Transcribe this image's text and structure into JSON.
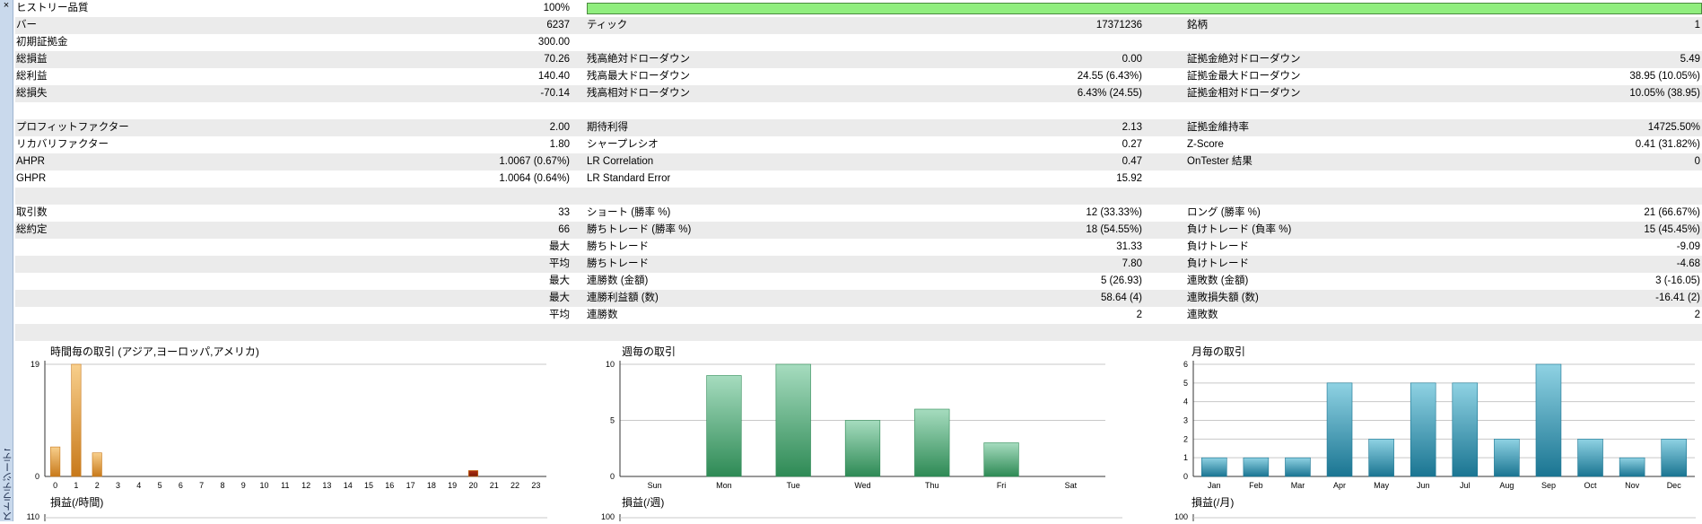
{
  "window": {
    "close_glyph": "×",
    "side_label": "ストラテジーテスター"
  },
  "report": {
    "rows": [
      {
        "l1": "ヒストリー品質",
        "v1": "100%",
        "bar": true,
        "alt": false,
        "history_quality_fraction": 1.0
      },
      {
        "l1": "バー",
        "v1": "6237",
        "l2": "ティック",
        "v2": "17371236",
        "l3": "銘柄",
        "v3": "1",
        "alt": true
      },
      {
        "l1": "初期証拠金",
        "v1": "300.00",
        "alt": false
      },
      {
        "l1": "総損益",
        "v1": "70.26",
        "l2": "残高絶対ドローダウン",
        "v2": "0.00",
        "l3": "証拠金絶対ドローダウン",
        "v3": "5.49",
        "alt": true
      },
      {
        "l1": "総利益",
        "v1": "140.40",
        "l2": "残高最大ドローダウン",
        "v2": "24.55 (6.43%)",
        "l3": "証拠金最大ドローダウン",
        "v3": "38.95 (10.05%)",
        "alt": false
      },
      {
        "l1": "総損失",
        "v1": "-70.14",
        "l2": "残高相対ドローダウン",
        "v2": "6.43% (24.55)",
        "l3": "証拠金相対ドローダウン",
        "v3": "10.05% (38.95)",
        "alt": true
      },
      {
        "alt": false
      },
      {
        "l1": "プロフィットファクター",
        "v1": "2.00",
        "l2": "期待利得",
        "v2": "2.13",
        "l3": "証拠金維持率",
        "v3": "14725.50%",
        "alt": true
      },
      {
        "l1": "リカバリファクター",
        "v1": "1.80",
        "l2": "シャープレシオ",
        "v2": "0.27",
        "l3": "Z-Score",
        "v3": "0.41 (31.82%)",
        "alt": false
      },
      {
        "l1": "AHPR",
        "v1": "1.0067 (0.67%)",
        "l2": "LR Correlation",
        "v2": "0.47",
        "l3": "OnTester 結果",
        "v3": "0",
        "alt": true
      },
      {
        "l1": "GHPR",
        "v1": "1.0064 (0.64%)",
        "l2": "LR Standard Error",
        "v2": "15.92",
        "alt": false
      },
      {
        "alt": true
      },
      {
        "l1": "取引数",
        "v1": "33",
        "l2": "ショート (勝率 %)",
        "v2": "12 (33.33%)",
        "l3": "ロング (勝率 %)",
        "v3": "21 (66.67%)",
        "alt": false
      },
      {
        "l1": "総約定",
        "v1": "66",
        "l2": "勝ちトレード (勝率 %)",
        "v2": "18 (54.55%)",
        "l3": "負けトレード (負率 %)",
        "v3": "15 (45.45%)",
        "alt": true
      },
      {
        "v1": "最大",
        "l2": "勝ちトレード",
        "v2": "31.33",
        "l3": "負けトレード",
        "v3": "-9.09",
        "alt": false
      },
      {
        "v1": "平均",
        "l2": "勝ちトレード",
        "v2": "7.80",
        "l3": "負けトレード",
        "v3": "-4.68",
        "alt": true
      },
      {
        "v1": "最大",
        "l2": "連勝数 (金額)",
        "v2": "5 (26.93)",
        "l3": "連敗数 (金額)",
        "v3": "3 (-16.05)",
        "alt": false
      },
      {
        "v1": "最大",
        "l2": "連勝利益額 (数)",
        "v2": "58.64 (4)",
        "l3": "連敗損失額 (数)",
        "v3": "-16.41 (2)",
        "alt": true
      },
      {
        "v1": "平均",
        "l2": "連勝数",
        "v2": "2",
        "l3": "連敗数",
        "v3": "2",
        "alt": false
      },
      {
        "alt": true
      }
    ]
  },
  "charts_bottom": {
    "hourly_profit_title": "損益(/時間)",
    "hourly_profit_ytop": "110",
    "weekly_profit_title": "損益(/週)",
    "weekly_profit_ytop": "100",
    "monthly_profit_title": "損益(/月)",
    "monthly_profit_ytop": "100"
  },
  "chart_data": [
    {
      "type": "bar",
      "title": "時間毎の取引 (アジア,ヨーロッパ,アメリカ)",
      "categories": [
        "0",
        "1",
        "2",
        "3",
        "4",
        "5",
        "6",
        "7",
        "8",
        "9",
        "10",
        "11",
        "12",
        "13",
        "14",
        "15",
        "16",
        "17",
        "18",
        "19",
        "20",
        "21",
        "22",
        "23"
      ],
      "values": [
        5,
        19,
        4,
        0,
        0,
        0,
        0,
        0,
        0,
        0,
        0,
        0,
        0,
        0,
        0,
        0,
        0,
        0,
        0,
        0,
        1,
        0,
        0,
        0
      ],
      "ylim": [
        0,
        19
      ],
      "yticks": [
        "0",
        "19"
      ],
      "colors": {
        "light": "#f8cf8c",
        "dark": "#c8791a",
        "red": "#b03010",
        "red_dark": "#7a1a08",
        "grid": "#c8c8c8"
      }
    },
    {
      "type": "bar",
      "title": "週毎の取引",
      "categories": [
        "Sun",
        "Mon",
        "Tue",
        "Wed",
        "Thu",
        "Fri",
        "Sat"
      ],
      "values": [
        0,
        9,
        10,
        5,
        6,
        3,
        0
      ],
      "ylim": [
        0,
        10
      ],
      "yticks": [
        "0",
        "5",
        "10"
      ],
      "colors": {
        "light": "#a6dcbf",
        "dark": "#2e8a55",
        "grid": "#c8c8c8"
      }
    },
    {
      "type": "bar",
      "title": "月毎の取引",
      "categories": [
        "Jan",
        "Feb",
        "Mar",
        "Apr",
        "May",
        "Jun",
        "Jul",
        "Aug",
        "Sep",
        "Oct",
        "Nov",
        "Dec"
      ],
      "values": [
        1,
        1,
        1,
        5,
        2,
        5,
        5,
        2,
        6,
        2,
        1,
        2
      ],
      "ylim": [
        0,
        6
      ],
      "yticks": [
        "0",
        "1",
        "2",
        "3",
        "4",
        "5",
        "6"
      ],
      "colors": {
        "light": "#8fd2e3",
        "dark": "#1a7592",
        "grid": "#c8c8c8"
      }
    }
  ]
}
